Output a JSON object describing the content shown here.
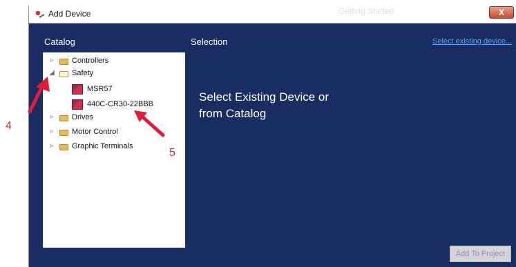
{
  "window": {
    "title": "Add Device",
    "background_title": "Getting Started",
    "close_label": "X"
  },
  "catalog": {
    "label": "Catalog",
    "items": [
      {
        "label": "Controllers",
        "expanded": false
      },
      {
        "label": "Safety",
        "expanded": true,
        "children": [
          "MSR57",
          "440C-CR30-22BBB"
        ]
      },
      {
        "label": "Drives",
        "expanded": false
      },
      {
        "label": "Motor Control",
        "expanded": false
      },
      {
        "label": "Graphic Terminals",
        "expanded": false
      }
    ]
  },
  "selection": {
    "label": "Selection",
    "existing_link": "Select existing device...",
    "message_line1": "Select Existing Device or",
    "message_line2": "from Catalog"
  },
  "buttons": {
    "add_to_project": "Add To Project"
  },
  "callouts": {
    "left": "4",
    "center": "5"
  },
  "colors": {
    "dialog_background": "#1a2d63",
    "annotation_red": "#e01c3a",
    "link_blue": "#5ca3ff"
  }
}
